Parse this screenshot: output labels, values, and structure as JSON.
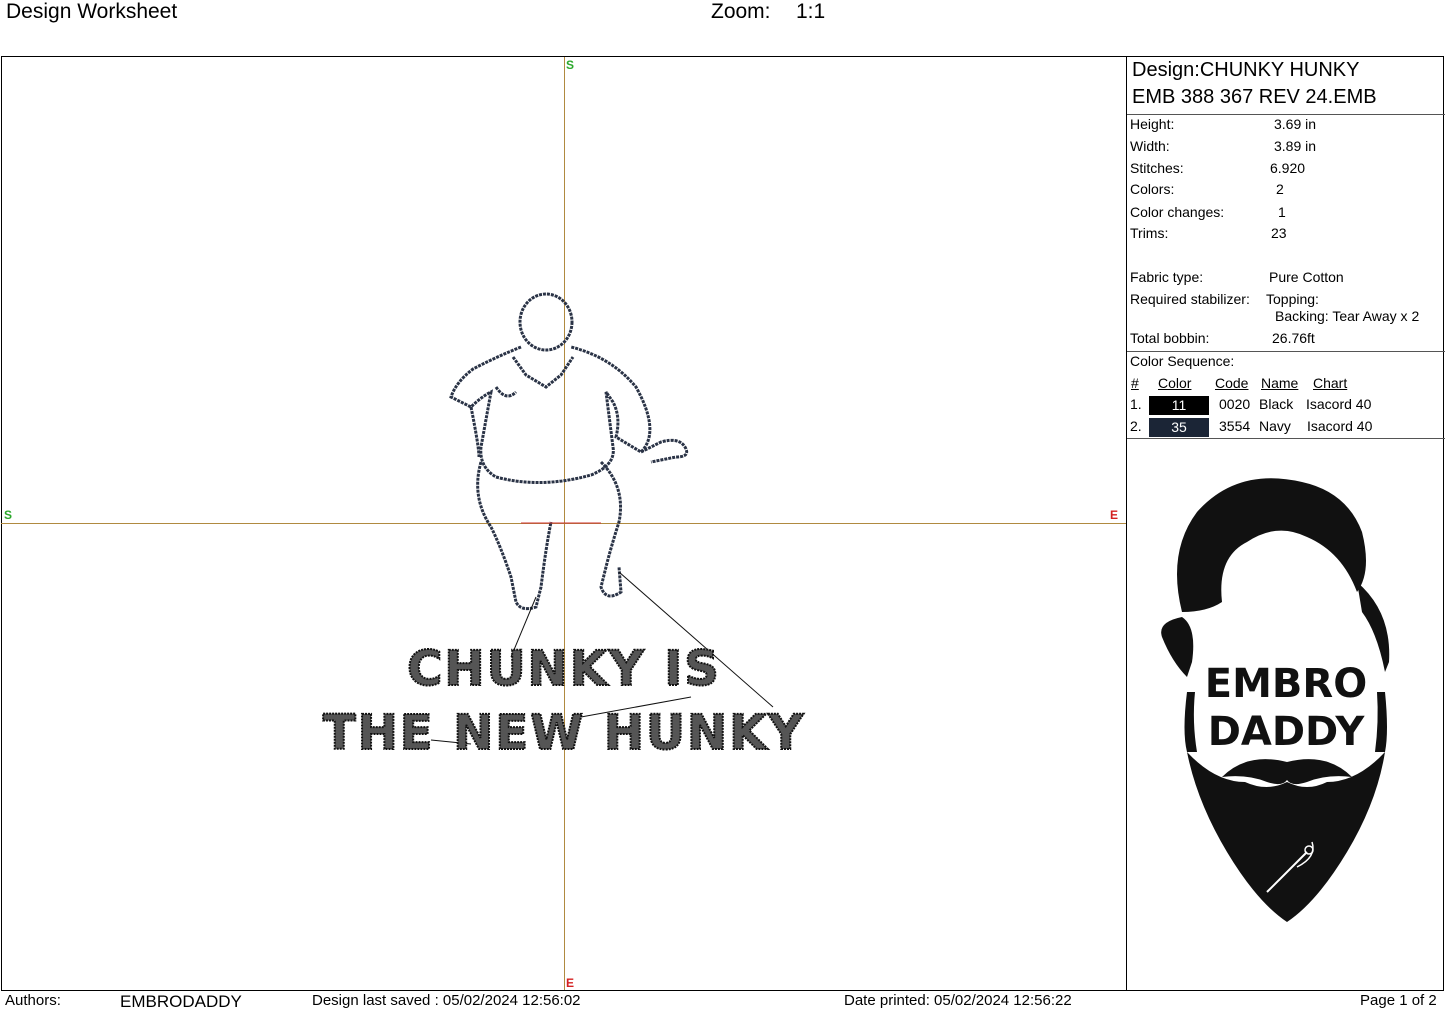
{
  "header": {
    "title": "Design Worksheet",
    "zoom_label": "Zoom:",
    "zoom_value": "1:1"
  },
  "canvas": {
    "axis_top": "S",
    "axis_left": "S",
    "axis_right": "E",
    "axis_bottom": "E",
    "design_text_line1": "CHUNKY IS",
    "design_text_line2": "THE NEW HUNKY"
  },
  "info": {
    "design_label": "Design:",
    "design_name": "CHUNKY HUNKY",
    "file_name": "EMB 388 367 REV 24.EMB",
    "stats": [
      {
        "label": "Height:",
        "value": "3.69 in"
      },
      {
        "label": "Width:",
        "value": "3.89 in"
      },
      {
        "label": "Stitches:",
        "value": "6.920"
      },
      {
        "label": "Colors:",
        "value": "2"
      },
      {
        "label": "Color changes:",
        "value": "1"
      },
      {
        "label": "Trims:",
        "value": "23"
      }
    ],
    "fabric_label": "Fabric type:",
    "fabric_value": "Pure Cotton",
    "stabilizer_label": "Required stabilizer:",
    "topping": "Topping:",
    "backing": "Backing: Tear Away x 2",
    "bobbin_label": "Total bobbin:",
    "bobbin_value": "26.76ft"
  },
  "color_sequence": {
    "title": "Color Sequence:",
    "headers": {
      "num": "#",
      "color": "Color",
      "code": "Code",
      "name": "Name",
      "chart": "Chart"
    },
    "rows": [
      {
        "num": "1.",
        "color": "11",
        "swatch": "#000000",
        "code": "0020",
        "name": "Black",
        "chart": "Isacord 40"
      },
      {
        "num": "2.",
        "color": "35",
        "swatch": "#1b2536",
        "code": "3554",
        "name": "Navy",
        "chart": "Isacord 40"
      }
    ]
  },
  "logo": {
    "line1": "EMBRO",
    "line2": "DADDY"
  },
  "footer": {
    "authors_label": "Authors:",
    "authors_value": "EMBRODADDY",
    "saved": "Design last saved : 05/02/2024 12:56:02",
    "printed": "Date printed: 05/02/2024 12:56:22",
    "page": "Page 1 of 2"
  },
  "colors": {
    "axis": "#b08a40",
    "axis_start": "#2ca82c",
    "axis_end": "#d42020",
    "navy_thread": "#1b2536"
  }
}
